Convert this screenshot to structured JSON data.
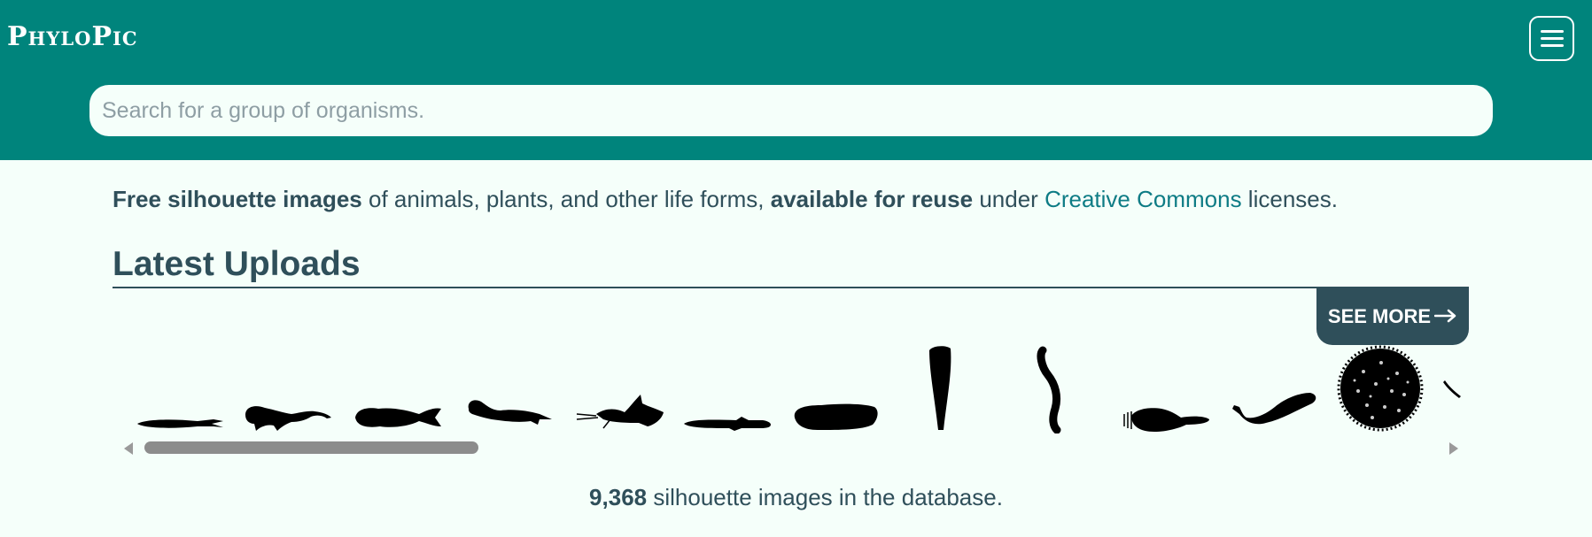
{
  "header": {
    "logo": "PhyloPic",
    "menu_icon": "hamburger-menu-icon"
  },
  "search": {
    "placeholder": "Search for a group of organisms."
  },
  "intro": {
    "bold1": "Free silhouette images",
    "text1": " of animals, plants, and other life forms, ",
    "bold2": "available for reuse",
    "text2": " under ",
    "link": "Creative Commons",
    "text3": " licenses."
  },
  "latest": {
    "title": "Latest Uploads",
    "see_more": "SEE MORE",
    "see_more_icon": "arrow-right-icon",
    "silhouettes": [
      {
        "name": "silhouette-slender-fish"
      },
      {
        "name": "silhouette-catfish"
      },
      {
        "name": "silhouette-catfish-2"
      },
      {
        "name": "silhouette-catfish-3"
      },
      {
        "name": "silhouette-whiskered-catfish"
      },
      {
        "name": "silhouette-eel-fish"
      },
      {
        "name": "silhouette-sea-cucumber"
      },
      {
        "name": "silhouette-worm-upright"
      },
      {
        "name": "silhouette-segmented-worm"
      },
      {
        "name": "silhouette-tentacled-worm"
      },
      {
        "name": "silhouette-fish-curved"
      },
      {
        "name": "silhouette-pollen-grain"
      },
      {
        "name": "silhouette-partial"
      }
    ],
    "scrollbar": {
      "left_icon": "scroll-left-icon",
      "right_icon": "scroll-right-icon",
      "position": 0.0
    }
  },
  "stats": {
    "count": "9,368",
    "text": " silhouette images in the database."
  },
  "colors": {
    "header": "#00847c",
    "background": "#f5fffa",
    "dark_slate": "#2f4f5a",
    "link": "#0e7c85"
  }
}
